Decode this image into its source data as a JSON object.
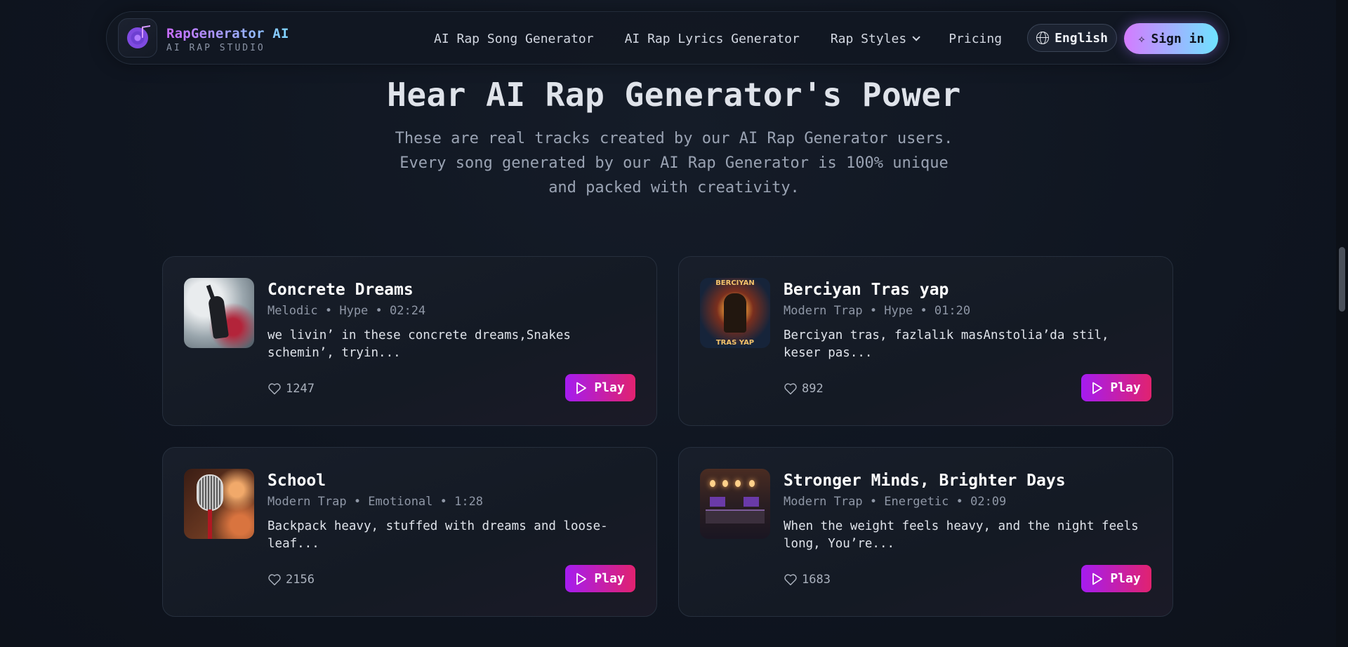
{
  "header": {
    "brand_name": "RapGenerator AI",
    "brand_sub": "AI RAP STUDIO",
    "nav": [
      {
        "label": "AI Rap Song Generator"
      },
      {
        "label": "AI Rap Lyrics Generator"
      },
      {
        "label": "Rap Styles",
        "has_dropdown": true
      },
      {
        "label": "Pricing"
      }
    ],
    "language_label": "English",
    "signin_label": "Sign in"
  },
  "hero": {
    "title": "Hear AI Rap Generator's Power",
    "subtitle_line1": "These are real tracks created by our AI Rap Generator users.",
    "subtitle_line2": "Every song generated by our AI Rap Generator is 100% unique",
    "subtitle_line3": "and packed with creativity."
  },
  "tracks": [
    {
      "title": "Concrete Dreams",
      "meta": "Melodic • Hype • 02:24",
      "lyric": "we livin’ in these concrete dreams,Snakes schemin’, tryin...",
      "likes": "1247",
      "play_label": "Play"
    },
    {
      "title": "Berciyan Tras yap",
      "meta": "Modern Trap • Hype • 01:20",
      "lyric": "Berciyan tras, fazlalık masAnstolia’da stil, keser pas...",
      "likes": "892",
      "play_label": "Play",
      "cover_text_top": "BERCIYAN",
      "cover_text_bottom": "TRAS YAP"
    },
    {
      "title": "School",
      "meta": "Modern Trap • Emotional • 1:28",
      "lyric": "Backpack heavy, stuffed with dreams and loose-leaf...",
      "likes": "2156",
      "play_label": "Play"
    },
    {
      "title": "Stronger Minds, Brighter Days",
      "meta": "Modern Trap • Energetic • 02:09",
      "lyric": "When the weight feels heavy, and the night feels long, You’re...",
      "likes": "1683",
      "play_label": "Play"
    }
  ],
  "colors": {
    "background": "#0f1520",
    "play_gradient_start": "#a51cf0",
    "play_gradient_end": "#e1226f",
    "signin_gradient_start": "#d47bff",
    "signin_gradient_end": "#6fe3ff"
  }
}
